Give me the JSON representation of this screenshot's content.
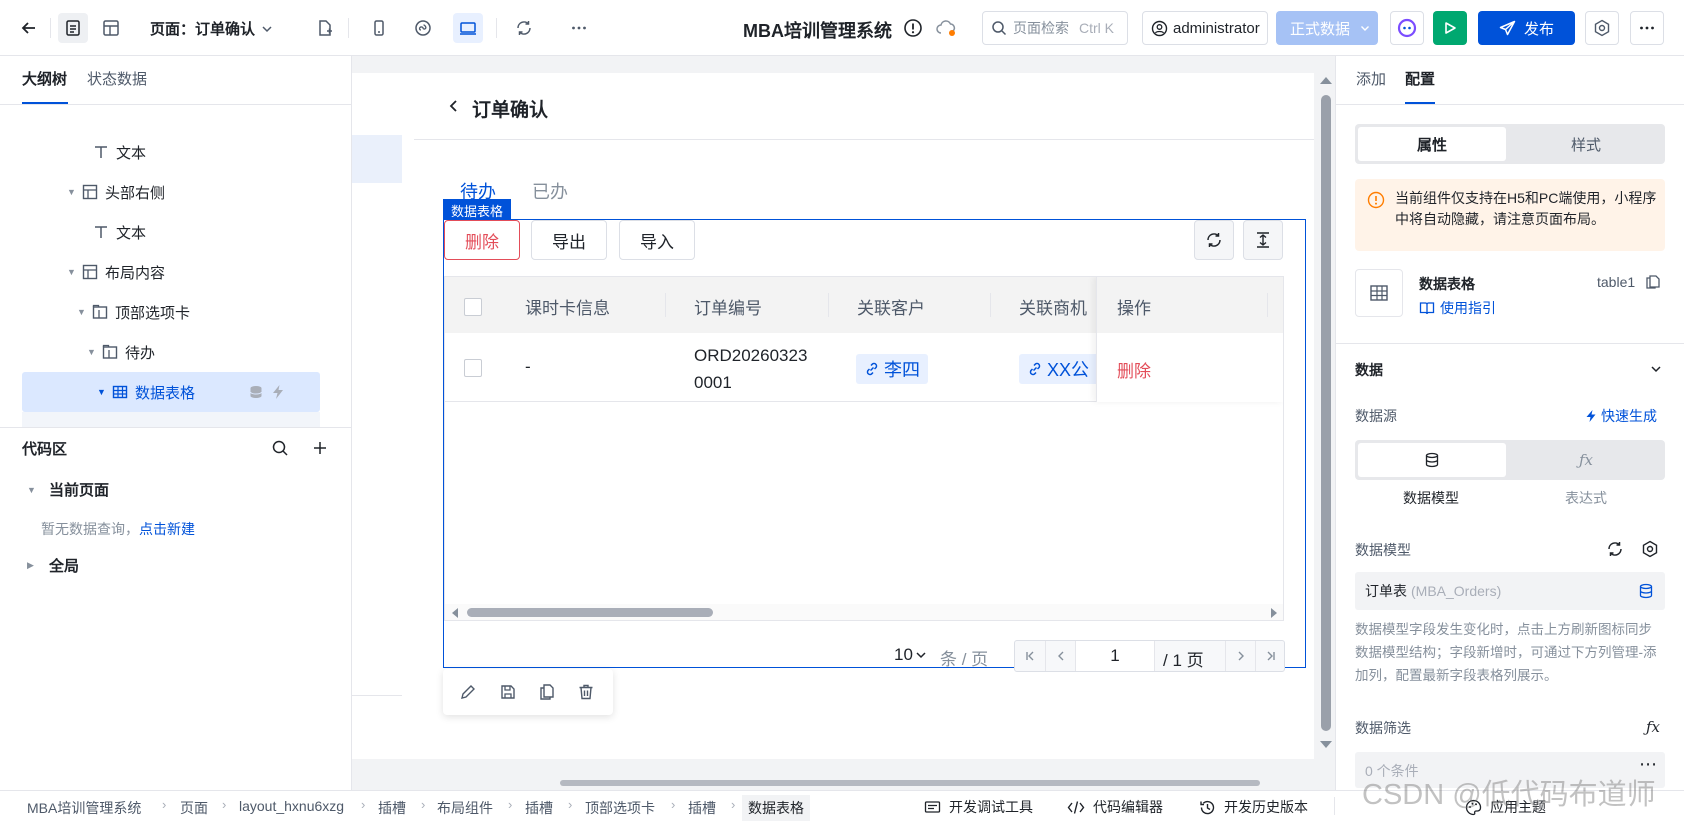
{
  "topbar": {
    "page_label": "页面：订单确认",
    "app_title": "MBA培训管理系统",
    "search_placeholder": "页面检索",
    "search_shortcut": "Ctrl K",
    "user": "administrator",
    "data_mode": "正式数据",
    "publish": "发布"
  },
  "left": {
    "tabs": [
      "大纲树",
      "状态数据"
    ],
    "tree": [
      {
        "label": "文本"
      },
      {
        "label": "头部右侧"
      },
      {
        "label": "文本"
      },
      {
        "label": "布局内容"
      },
      {
        "label": "顶部选项卡"
      },
      {
        "label": "待办"
      },
      {
        "label": "数据表格"
      }
    ],
    "code_area": {
      "title": "代码区",
      "current_page": "当前页面",
      "empty_text": "暂无数据查询，",
      "new_link": "点击新建",
      "global": "全局"
    }
  },
  "canvas": {
    "page_title": "订单确认",
    "tabs": [
      "待办",
      "已办"
    ],
    "selection_tag": "数据表格",
    "actions": [
      "删除",
      "导出",
      "导入"
    ],
    "table": {
      "columns": [
        "课时卡信息",
        "订单编号",
        "关联客户",
        "关联商机",
        "操作"
      ],
      "rows": [
        {
          "card": "-",
          "order_no_1": "ORD20260323",
          "order_no_2": "0001",
          "customer": "李四",
          "opportunity": "XX公",
          "op": "删除"
        }
      ]
    },
    "pagination": {
      "page_size": "10",
      "per_page_suffix": "条 / 页",
      "current": "1",
      "total": "/ 1 页"
    }
  },
  "right": {
    "tabs": [
      "添加",
      "配置"
    ],
    "seg": [
      "属性",
      "样式"
    ],
    "notice": "当前组件仅支持在H5和PC端使用，小程序中将自动隐藏，请注意页面布局。",
    "component_name": "数据表格",
    "component_id": "table1",
    "guide_link": "使用指引",
    "section_data": "数据",
    "data_source_label": "数据源",
    "quick_gen": "快速生成",
    "source_opts": [
      "数据模型",
      "表达式"
    ],
    "data_model_label": "数据模型",
    "model_name": "订单表",
    "model_code": "(MBA_Orders)",
    "model_help": "数据模型字段发生变化时，点击上方刷新图标同步数据模型结构；字段新增时，可通过下方列管理-添加列，配置最新字段表格列展示。",
    "filter_label": "数据筛选",
    "filter_value": "0 个条件"
  },
  "bottom": {
    "breadcrumbs": [
      "MBA培训管理系统",
      "页面",
      "layout_hxnu6xzg",
      "插槽",
      "布局组件",
      "插槽",
      "顶部选项卡",
      "插槽",
      "数据表格"
    ],
    "tools": [
      "开发调试工具",
      "代码编辑器",
      "开发历史版本"
    ],
    "theme": "应用主题"
  },
  "watermark": "CSDN @低代码布道师",
  "colors": {
    "primary": "#0052d9",
    "danger": "#e34d59",
    "selected_bg": "#dbe8ff",
    "green": "#00a870"
  }
}
